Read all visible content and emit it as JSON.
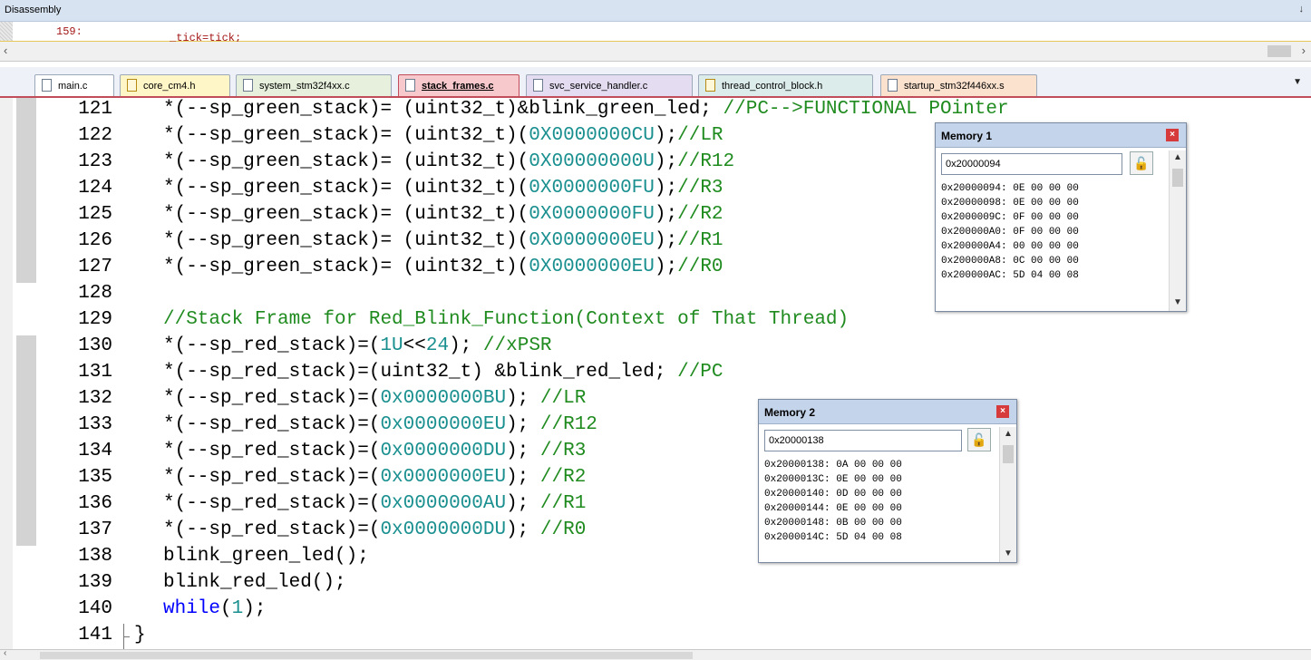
{
  "disassembly": {
    "title": "Disassembly",
    "pin": "↓",
    "line_num": "159:",
    "line_code": "_tick=tick;"
  },
  "tabs": [
    {
      "label": "main.c",
      "type": "c"
    },
    {
      "label": "core_cm4.h",
      "type": "h"
    },
    {
      "label": "system_stm32f4xx.c",
      "type": "c"
    },
    {
      "label": "stack_frames.c",
      "type": "c",
      "active": true
    },
    {
      "label": "svc_service_handler.c",
      "type": "c"
    },
    {
      "label": "thread_control_block.h",
      "type": "h"
    },
    {
      "label": "startup_stm32f446xx.s",
      "type": "s"
    }
  ],
  "editor": {
    "lines": [
      {
        "num": "121",
        "code": [
          {
            "t": "*(--sp_green_stack)= (uint32_t)&blink_green_led; "
          },
          {
            "t": "//PC-->FUNCTIONAL POinter",
            "c": "cmt"
          }
        ]
      },
      {
        "num": "122",
        "code": [
          {
            "t": "*(--sp_green_stack)= (uint32_t)("
          },
          {
            "t": "0X0000000CU",
            "c": "num"
          },
          {
            "t": ");"
          },
          {
            "t": "//LR",
            "c": "cmt"
          }
        ]
      },
      {
        "num": "123",
        "code": [
          {
            "t": "*(--sp_green_stack)= (uint32_t)("
          },
          {
            "t": "0X00000000U",
            "c": "num"
          },
          {
            "t": ");"
          },
          {
            "t": "//R12",
            "c": "cmt"
          }
        ]
      },
      {
        "num": "124",
        "code": [
          {
            "t": "*(--sp_green_stack)= (uint32_t)("
          },
          {
            "t": "0X0000000FU",
            "c": "num"
          },
          {
            "t": ");"
          },
          {
            "t": "//R3",
            "c": "cmt"
          }
        ]
      },
      {
        "num": "125",
        "code": [
          {
            "t": "*(--sp_green_stack)= (uint32_t)("
          },
          {
            "t": "0X0000000FU",
            "c": "num"
          },
          {
            "t": ");"
          },
          {
            "t": "//R2",
            "c": "cmt"
          }
        ]
      },
      {
        "num": "126",
        "code": [
          {
            "t": "*(--sp_green_stack)= (uint32_t)("
          },
          {
            "t": "0X0000000EU",
            "c": "num"
          },
          {
            "t": ");"
          },
          {
            "t": "//R1",
            "c": "cmt"
          }
        ]
      },
      {
        "num": "127",
        "code": [
          {
            "t": "*(--sp_green_stack)= (uint32_t)("
          },
          {
            "t": "0X0000000EU",
            "c": "num"
          },
          {
            "t": ");"
          },
          {
            "t": "//R0",
            "c": "cmt"
          }
        ]
      },
      {
        "num": "128",
        "code": []
      },
      {
        "num": "129",
        "code": [
          {
            "t": "//Stack Frame for Red_Blink_Function(Context of That Thread)",
            "c": "cmt"
          }
        ]
      },
      {
        "num": "130",
        "code": [
          {
            "t": "*(--sp_red_stack)=("
          },
          {
            "t": "1U",
            "c": "num"
          },
          {
            "t": "<<"
          },
          {
            "t": "24",
            "c": "num"
          },
          {
            "t": "); "
          },
          {
            "t": "//xPSR",
            "c": "cmt"
          }
        ]
      },
      {
        "num": "131",
        "code": [
          {
            "t": "*(--sp_red_stack)=(uint32_t) &blink_red_led; "
          },
          {
            "t": "//PC",
            "c": "cmt"
          }
        ]
      },
      {
        "num": "132",
        "code": [
          {
            "t": "*(--sp_red_stack)=("
          },
          {
            "t": "0x0000000BU",
            "c": "num"
          },
          {
            "t": "); "
          },
          {
            "t": "//LR",
            "c": "cmt"
          }
        ]
      },
      {
        "num": "133",
        "code": [
          {
            "t": "*(--sp_red_stack)=("
          },
          {
            "t": "0x0000000EU",
            "c": "num"
          },
          {
            "t": "); "
          },
          {
            "t": "//R12",
            "c": "cmt"
          }
        ]
      },
      {
        "num": "134",
        "code": [
          {
            "t": "*(--sp_red_stack)=("
          },
          {
            "t": "0x0000000DU",
            "c": "num"
          },
          {
            "t": "); "
          },
          {
            "t": "//R3",
            "c": "cmt"
          }
        ]
      },
      {
        "num": "135",
        "code": [
          {
            "t": "*(--sp_red_stack)=("
          },
          {
            "t": "0x0000000EU",
            "c": "num"
          },
          {
            "t": "); "
          },
          {
            "t": "//R2",
            "c": "cmt"
          }
        ]
      },
      {
        "num": "136",
        "code": [
          {
            "t": "*(--sp_red_stack)=("
          },
          {
            "t": "0x0000000AU",
            "c": "num"
          },
          {
            "t": "); "
          },
          {
            "t": "//R1",
            "c": "cmt"
          }
        ]
      },
      {
        "num": "137",
        "code": [
          {
            "t": "*(--sp_red_stack)=("
          },
          {
            "t": "0x0000000DU",
            "c": "num"
          },
          {
            "t": "); "
          },
          {
            "t": "//R0",
            "c": "cmt"
          }
        ]
      },
      {
        "num": "138",
        "code": [
          {
            "t": "blink_green_led();"
          }
        ]
      },
      {
        "num": "139",
        "code": [
          {
            "t": "blink_red_led();"
          }
        ]
      },
      {
        "num": "140",
        "code": [
          {
            "t": "while",
            "c": "kw"
          },
          {
            "t": "("
          },
          {
            "t": "1",
            "c": "num"
          },
          {
            "t": ");"
          }
        ]
      },
      {
        "num": "141",
        "code": [
          {
            "t": "}"
          }
        ]
      }
    ]
  },
  "memory1": {
    "title": "Memory 1",
    "address": "0x20000094",
    "rows": [
      "0x20000094: 0E 00 00 00",
      "0x20000098: 0E 00 00 00",
      "0x2000009C: 0F 00 00 00",
      "0x200000A0: 0F 00 00 00",
      "0x200000A4: 00 00 00 00",
      "0x200000A8: 0C 00 00 00",
      "0x200000AC: 5D 04 00 08"
    ]
  },
  "memory2": {
    "title": "Memory 2",
    "address": "0x20000138",
    "rows": [
      "0x20000138: 0A 00 00 00",
      "0x2000013C: 0E 00 00 00",
      "0x20000140: 0D 00 00 00",
      "0x20000144: 0E 00 00 00",
      "0x20000148: 0B 00 00 00",
      "0x2000014C: 5D 04 00 08"
    ]
  },
  "colors": {
    "title_bar": "#d7e3f1",
    "active_tab_border": "#c24d5a",
    "comment": "#1f8b1f",
    "number": "#1a8f8f",
    "keyword": "#0000ff"
  }
}
